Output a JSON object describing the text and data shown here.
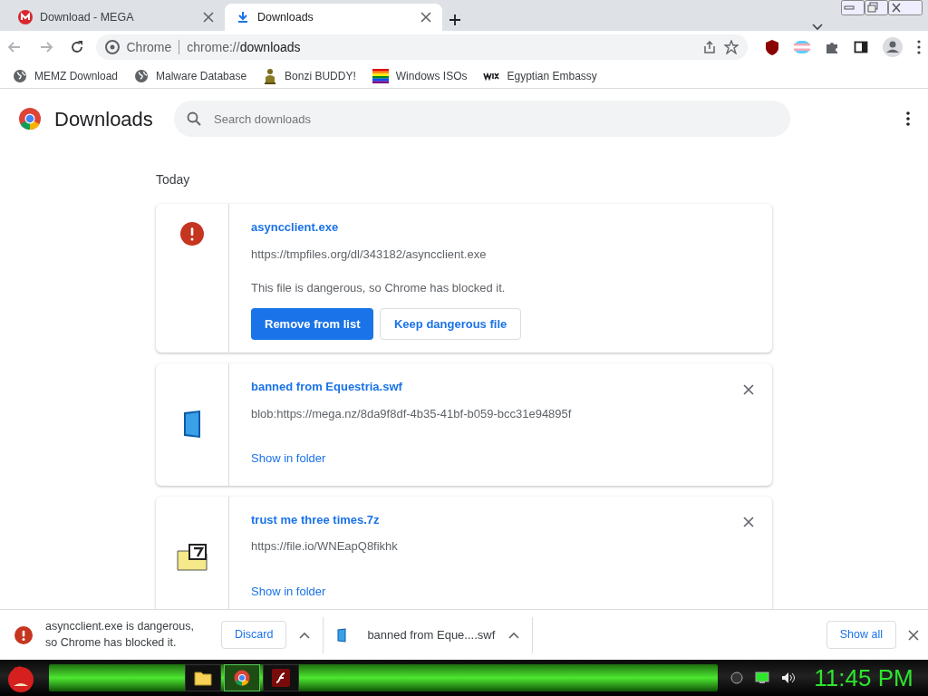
{
  "tabs": [
    {
      "title": "Download - MEGA",
      "kind": "mega",
      "selected": false
    },
    {
      "title": "Downloads",
      "kind": "download",
      "selected": true
    }
  ],
  "address": {
    "origin_label": "Chrome",
    "url_scheme": "chrome://",
    "url_path": "downloads"
  },
  "bookmarks": [
    {
      "label": "MEMZ Download",
      "kind": "globe"
    },
    {
      "label": "Malware Database",
      "kind": "globe"
    },
    {
      "label": "Bonzi BUDDY!",
      "kind": "figure"
    },
    {
      "label": "Windows ISOs",
      "kind": "rainbow"
    },
    {
      "label": "Egyptian Embassy",
      "kind": "wix"
    }
  ],
  "page": {
    "title": "Downloads",
    "search_placeholder": "Search downloads",
    "section": "Today"
  },
  "downloads": [
    {
      "kind": "dangerous",
      "filename": "asyncclient.exe",
      "url": "https://tmpfiles.org/dl/343182/asyncclient.exe",
      "message": "This file is dangerous, so Chrome has blocked it.",
      "primary_button": "Remove from list",
      "secondary_button": "Keep dangerous file"
    },
    {
      "kind": "swf",
      "filename": "banned from Equestria.swf",
      "url": "blob:https://mega.nz/8da9f8df-4b35-41bf-b059-bcc31e94895f",
      "link": "Show in folder"
    },
    {
      "kind": "archive",
      "filename": "trust me three times.7z",
      "url": "https://file.io/WNEapQ8fikhk",
      "link": "Show in folder"
    }
  ],
  "shelf": {
    "items": [
      {
        "kind": "dangerous",
        "text": "asyncclient.exe is dangerous, so Chrome has blocked it.",
        "button": "Discard"
      },
      {
        "kind": "swf",
        "text": "banned from Eque....swf"
      }
    ],
    "show_all": "Show all"
  },
  "taskbar": {
    "apps": [
      {
        "kind": "folder",
        "selected": false
      },
      {
        "kind": "chrome",
        "selected": true
      },
      {
        "kind": "flash",
        "selected": false
      }
    ],
    "clock": "11:45 PM"
  }
}
